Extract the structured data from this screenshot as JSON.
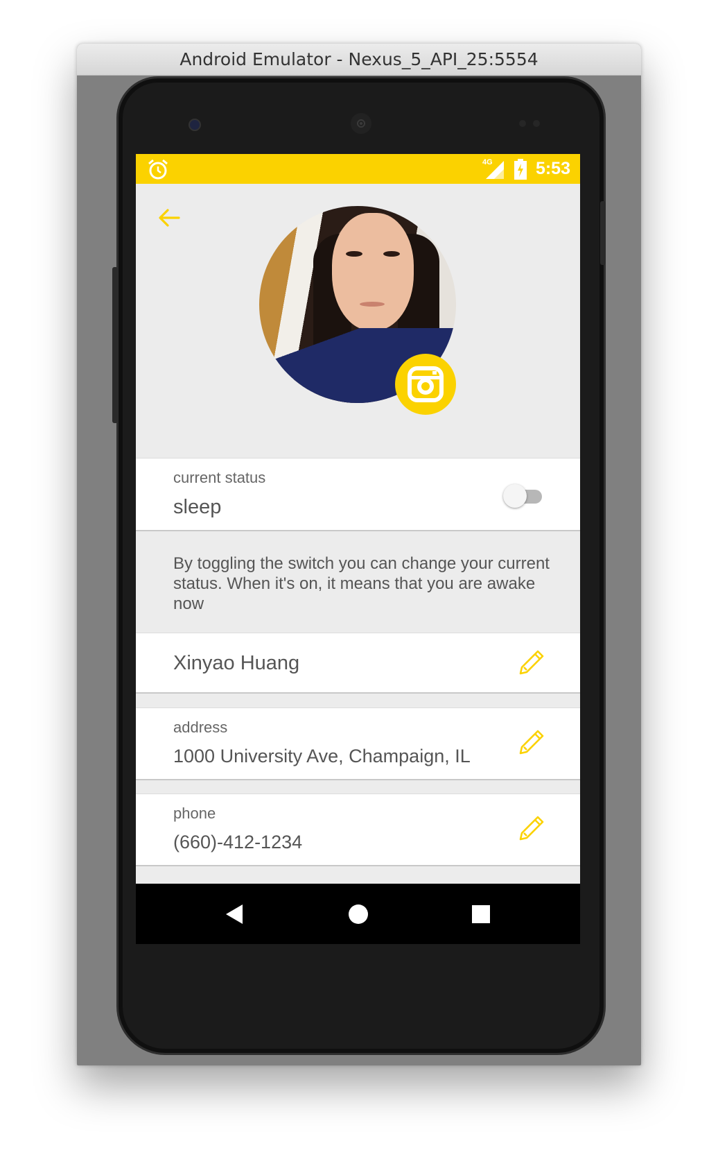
{
  "window": {
    "title": "Android Emulator - Nexus_5_API_25:5554"
  },
  "statusbar": {
    "time": "5:53",
    "network": "4G",
    "icons": [
      "alarm-icon",
      "signal-icon",
      "battery-icon"
    ],
    "color": "#fbd200"
  },
  "profile": {
    "back_icon": "arrow-left-icon",
    "avatar_icon": "profile-photo",
    "camera_icon": "instagram-camera-icon",
    "accent": "#fbd200"
  },
  "status_card": {
    "label": "current status",
    "value": "sleep",
    "toggle_on": false
  },
  "hint": "By toggling the switch you can change your current status. When it's on, it means that you are awake now",
  "name_card": {
    "value": "Xinyao Huang",
    "edit_icon": "pencil-icon"
  },
  "address_card": {
    "label": "address",
    "value": "1000 University Ave, Champaign, IL",
    "edit_icon": "pencil-icon"
  },
  "phone_card": {
    "label": "phone",
    "value": "(660)-412-1234",
    "edit_icon": "pencil-icon"
  },
  "navbar": {
    "icons": [
      "back-triangle-icon",
      "home-circle-icon",
      "recents-square-icon"
    ]
  }
}
